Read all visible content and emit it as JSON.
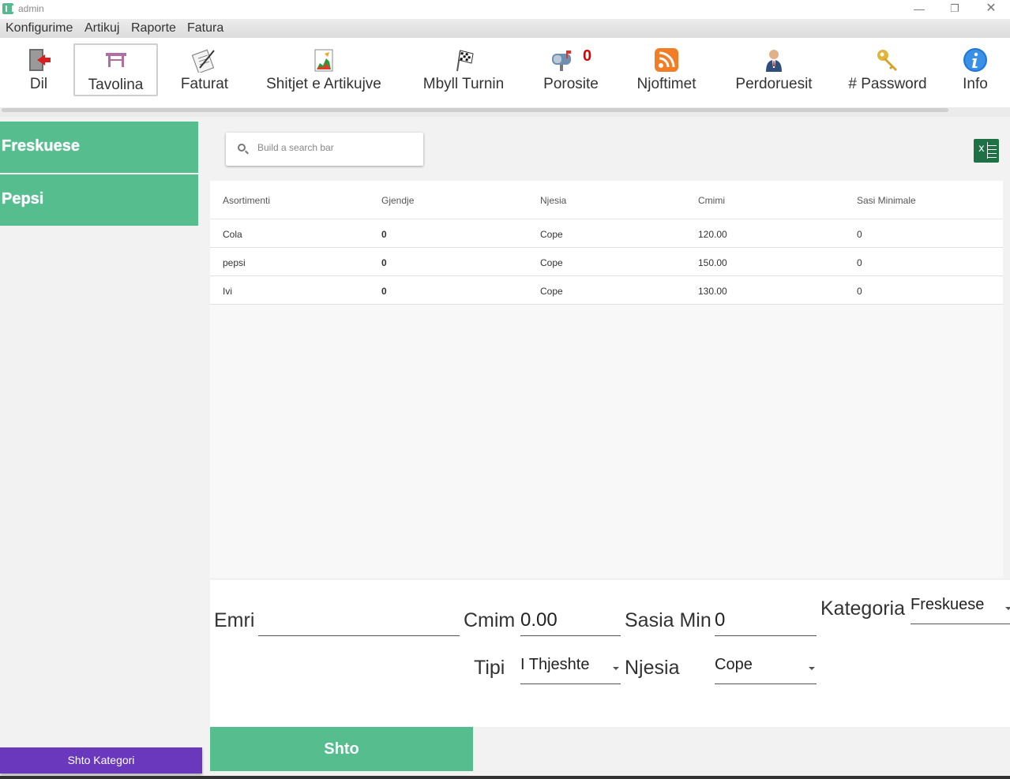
{
  "window": {
    "title": "admin"
  },
  "menu": [
    "Konfigurime",
    "Artikuj",
    "Raporte",
    "Fatura"
  ],
  "toolbar": {
    "dil": "Dil",
    "tavolina": "Tavolina",
    "faturat": "Faturat",
    "shitjet": "Shitjet e Artikujve",
    "mbyll": "Mbyll Turnin",
    "porosite": "Porosite",
    "porosite_count": "0",
    "njoftimet": "Njoftimet",
    "perdoruesit": "Perdoruesit",
    "password": "# Password",
    "info": "Info"
  },
  "categories": [
    "Freskuese",
    "Pepsi"
  ],
  "add_category_label": "Shto Kategori",
  "search": {
    "placeholder": "Build a search bar"
  },
  "table": {
    "headers": [
      "Asortimenti",
      "Gjendje",
      "Njesia",
      "Cmimi",
      "Sasi Minimale"
    ],
    "rows": [
      [
        "Cola",
        "0",
        "Cope",
        "120.00",
        "0"
      ],
      [
        "pepsi",
        "0",
        "Cope",
        "150.00",
        "0"
      ],
      [
        "Ivi",
        "0",
        "Cope",
        "130.00",
        "0"
      ]
    ]
  },
  "form": {
    "emri_label": "Emri",
    "emri_value": "",
    "cmim_label": "Cmim",
    "cmim_value": "0.00",
    "sasia_label": "Sasia Min",
    "sasia_value": "0",
    "kategoria_label": "Kategoria",
    "kategoria_value": "Freskuese",
    "tipi_label": "Tipi",
    "tipi_value": "I Thjeshte",
    "njesia_label": "Njesia",
    "njesia_value": "Cope"
  },
  "submit_label": "Shto",
  "colors": {
    "accent_green": "#56bd8f",
    "purple": "#6a38bd",
    "badge_red": "#e00000",
    "excel_green": "#1e7145"
  }
}
